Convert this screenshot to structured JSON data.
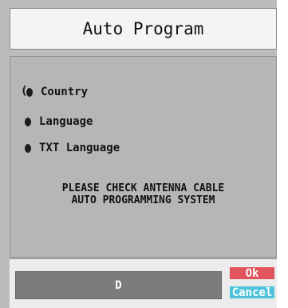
{
  "dialog": {
    "title": "Auto Program"
  },
  "options": [
    {
      "label": "Country",
      "bullet_icon": "dot-icon",
      "selected": true
    },
    {
      "label": "Language",
      "bullet_icon": "dot-icon",
      "selected": false
    },
    {
      "label": "TXT Language",
      "bullet_icon": "dot-icon",
      "selected": false
    }
  ],
  "message": {
    "line1": "PLEASE CHECK ANTENNA CABLE",
    "line2": "AUTO PROGRAMMING SYSTEM"
  },
  "bottom": {
    "field_value": "D",
    "ok_label": "Ok",
    "cancel_label": "Cancel"
  },
  "colors": {
    "ok_button": "#e0555c",
    "cancel_button": "#4ec4dc",
    "panel_bg": "#b6b6b6"
  }
}
